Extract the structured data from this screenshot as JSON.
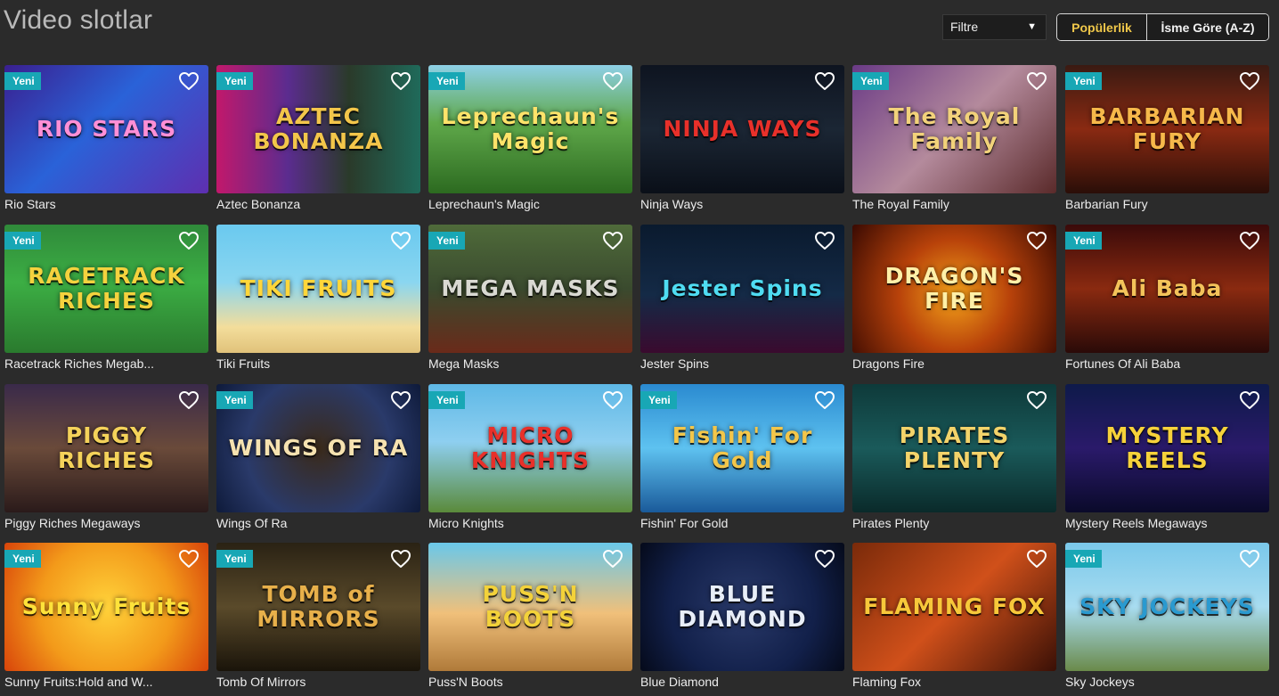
{
  "page": {
    "title": "Video slotlar",
    "filter": {
      "label": "Filtre"
    },
    "sort": {
      "popular": "Popülerlik",
      "alpha": "İsme Göre (A-Z)"
    },
    "badge_text": "Yeni"
  },
  "games": [
    {
      "title": "Rio Stars",
      "logo": "RIO STARS",
      "is_new": true,
      "bg": "linear-gradient(135deg,#3a1f8f 0%,#2a62d8 45%,#5e2fb0 100%)",
      "logo_color": "#ff8fd6"
    },
    {
      "title": "Aztec Bonanza",
      "logo": "AZTEC BONANZA",
      "is_new": true,
      "bg": "linear-gradient(90deg,#c2186b 0%,#5b2c8f 35%,#2a3a2a 65%,#1f6a5a 100%)",
      "logo_color": "#f3c64a"
    },
    {
      "title": "Leprechaun's Magic",
      "logo": "Leprechaun's Magic",
      "is_new": true,
      "bg": "linear-gradient(180deg,#8ed0e6 0%,#5fa84a 45%,#2c6a20 100%)",
      "logo_color": "#ffe36a"
    },
    {
      "title": "Ninja Ways",
      "logo": "NINJA WAYS",
      "is_new": false,
      "bg": "linear-gradient(180deg,#0e1420 0%,#1b2634 50%,#0a0f18 100%)",
      "logo_color": "#e8302a"
    },
    {
      "title": "The Royal Family",
      "logo": "The Royal Family",
      "is_new": true,
      "bg": "linear-gradient(135deg,#6a3a86 0%,#b48a9c 50%,#5a2a2a 100%)",
      "logo_color": "#f2d27a"
    },
    {
      "title": "Barbarian Fury",
      "logo": "BARBARIAN FURY",
      "is_new": true,
      "bg": "linear-gradient(180deg,#3a1a12 0%,#8a2a12 50%,#2a0e08 100%)",
      "logo_color": "#f6b84a"
    },
    {
      "title": "Racetrack Riches Megab...",
      "logo": "RACETRACK RICHES",
      "is_new": true,
      "bg": "linear-gradient(180deg,#2f8a3a 0%,#3cae44 45%,#2a7a2e 100%)",
      "logo_color": "#f4d23e"
    },
    {
      "title": "Tiki Fruits",
      "logo": "TIKI FRUITS",
      "is_new": false,
      "bg": "linear-gradient(180deg,#6ac9ef 0%,#8ad6f0 45%,#f3dd9b 80%,#e0c27a 100%)",
      "logo_color": "#ffd63a"
    },
    {
      "title": "Mega Masks",
      "logo": "MEGA MASKS",
      "is_new": true,
      "bg": "linear-gradient(180deg,#4f6b3a 0%,#3a4a2e 50%,#6a2a1a 100%)",
      "logo_color": "#d9d9d2"
    },
    {
      "title": "Jester Spins",
      "logo": "Jester Spins",
      "is_new": false,
      "bg": "linear-gradient(180deg,#0a1a2e 0%,#142a46 55%,#3a0a2e 100%)",
      "logo_color": "#4fdcf2"
    },
    {
      "title": "Dragons Fire",
      "logo": "DRAGON'S FIRE",
      "is_new": false,
      "bg": "radial-gradient(circle at 50% 55%,#f3a21a 0%,#b8420a 45%,#3a0a02 100%)",
      "logo_color": "#fff0a8"
    },
    {
      "title": "Fortunes Of Ali Baba",
      "logo": "Ali Baba",
      "is_new": true,
      "bg": "linear-gradient(180deg,#3a0a0a 0%,#8a2a10 50%,#2a0a08 100%)",
      "logo_color": "#f3c35a"
    },
    {
      "title": "Piggy Riches Megaways",
      "logo": "PIGGY RICHES",
      "is_new": false,
      "bg": "linear-gradient(180deg,#3a2a4a 0%,#6a4a3a 50%,#2a1a1a 100%)",
      "logo_color": "#f4d25a"
    },
    {
      "title": "Wings Of Ra",
      "logo": "WINGS OF RA",
      "is_new": true,
      "bg": "radial-gradient(circle at 50% 50%,#3a2a1a 0%,#2a3a6a 60%,#0e1a3a 100%)",
      "logo_color": "#f6e2b0"
    },
    {
      "title": "Micro Knights",
      "logo": "MICRO KNIGHTS",
      "is_new": true,
      "bg": "linear-gradient(180deg,#5eb8e6 0%,#8ecff0 45%,#5a8a3a 100%)",
      "logo_color": "#e8302a"
    },
    {
      "title": "Fishin' For Gold",
      "logo": "Fishin' For Gold",
      "is_new": true,
      "bg": "linear-gradient(180deg,#2a8ad0 0%,#5ec2f0 50%,#1a5a9a 100%)",
      "logo_color": "#f3c64a"
    },
    {
      "title": "Pirates Plenty",
      "logo": "PIRATES PLENTY",
      "is_new": false,
      "bg": "linear-gradient(180deg,#0e3a3a 0%,#1a5a5a 50%,#0a2a2a 100%)",
      "logo_color": "#f3d36a"
    },
    {
      "title": "Mystery Reels Megaways",
      "logo": "MYSTERY REELS",
      "is_new": false,
      "bg": "linear-gradient(180deg,#0e1a4a 0%,#2a1a6a 50%,#0a0a2a 100%)",
      "logo_color": "#f6d23a"
    },
    {
      "title": "Sunny Fruits:Hold and W...",
      "logo": "Sunny Fruits",
      "is_new": true,
      "bg": "radial-gradient(circle at 50% 50%,#ffd23a 0%,#f39a1a 55%,#d8440a 100%)",
      "logo_color": "#ffe23a"
    },
    {
      "title": "Tomb Of Mirrors",
      "logo": "TOMB of MIRRORS",
      "is_new": true,
      "bg": "linear-gradient(180deg,#2a2214 0%,#5a4a2a 50%,#1a140a 100%)",
      "logo_color": "#e8b04a"
    },
    {
      "title": "Puss'N Boots",
      "logo": "PUSS'N BOOTS",
      "is_new": false,
      "bg": "linear-gradient(180deg,#6ac8ea 0%,#f0c07a 55%,#b07a3a 100%)",
      "logo_color": "#f3d23a"
    },
    {
      "title": "Blue Diamond",
      "logo": "BLUE DIAMOND",
      "is_new": false,
      "bg": "radial-gradient(circle at 50% 50%,#2a3a6a 0%,#12204a 60%,#050a1a 100%)",
      "logo_color": "#e8eef8"
    },
    {
      "title": "Flaming Fox",
      "logo": "FLAMING FOX",
      "is_new": false,
      "bg": "linear-gradient(135deg,#7a2a0a 0%,#d0501a 50%,#3a1006 100%)",
      "logo_color": "#f7c83a"
    },
    {
      "title": "Sky Jockeys",
      "logo": "SKY JOCKEYS",
      "is_new": true,
      "bg": "linear-gradient(180deg,#7ac8ea 0%,#a8dcf0 50%,#6a8a4a 100%)",
      "logo_color": "#2a9ad0"
    }
  ]
}
